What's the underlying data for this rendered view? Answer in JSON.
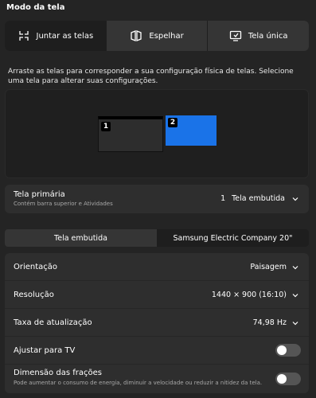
{
  "section": {
    "title": "Modo da tela"
  },
  "modes": [
    {
      "label": "Juntar as telas",
      "icon": "join-displays-icon",
      "active": true
    },
    {
      "label": "Espelhar",
      "icon": "mirror-icon",
      "active": false
    },
    {
      "label": "Tela única",
      "icon": "single-display-icon",
      "active": false
    }
  ],
  "description": "Arraste as telas para corresponder a sua configuração física de telas. Selecione uma tela para alterar suas configurações.",
  "arrangement": {
    "monitors": [
      {
        "number": "1"
      },
      {
        "number": "2",
        "selected": true
      }
    ]
  },
  "primary": {
    "title": "Tela primária",
    "subtitle": "Contém barra superior e Atividades",
    "value_number": "1",
    "value_label": "Tela embutida"
  },
  "display_tabs": [
    {
      "label": "Tela embutida",
      "active": false
    },
    {
      "label": "Samsung Electric Company 20\"",
      "active": true
    }
  ],
  "settings": {
    "orientation": {
      "label": "Orientação",
      "value": "Paisagem"
    },
    "resolution": {
      "label": "Resolução",
      "value": "1440 × 900 (16:10)"
    },
    "refresh_rate": {
      "label": "Taxa de atualização",
      "value": "74,98 Hz"
    },
    "fit_tv": {
      "label": "Ajustar para TV",
      "enabled": false
    },
    "fractional_scaling": {
      "label": "Dimensão das frações",
      "subtitle": "Pode aumentar o consumo de energia, diminuir a velocidade ou reduzir a nitidez da tela.",
      "enabled": false
    }
  },
  "colors": {
    "accent": "#1a73e8",
    "background": "#242424",
    "card": "#2e2e2e"
  }
}
